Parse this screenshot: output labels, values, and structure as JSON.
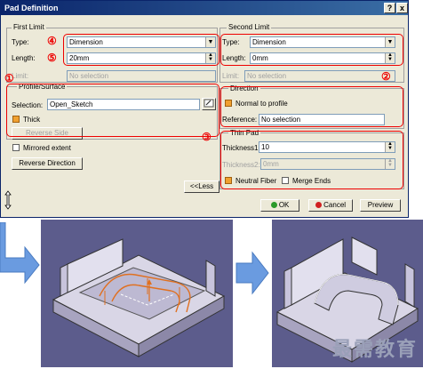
{
  "dialog": {
    "title": "Pad Definition",
    "help_label": "?",
    "close_label": "x"
  },
  "first_limit": {
    "legend": "First Limit",
    "type_label": "Type:",
    "type_value": "Dimension",
    "length_label": "Length:",
    "length_value": "20mm",
    "limit_label": "Limit:",
    "limit_value": "No selection"
  },
  "profile": {
    "legend": "Profile/Surface",
    "selection_label": "Selection:",
    "selection_value": "Open_Sketch",
    "thick_label": "Thick",
    "reverse_side_label": "Reverse Side"
  },
  "options": {
    "mirrored_label": "Mirrored extent",
    "reverse_direction_label": "Reverse Direction",
    "less_label": "<<Less"
  },
  "second_limit": {
    "legend": "Second Limit",
    "type_label": "Type:",
    "type_value": "Dimension",
    "length_label": "Length:",
    "length_value": "0mm",
    "limit_label": "Limit:",
    "limit_value": "No selection"
  },
  "direction": {
    "legend": "Direction",
    "normal_label": "Normal to profile",
    "reference_label": "Reference:",
    "reference_value": "No selection"
  },
  "thin_pad": {
    "legend": "Thin Pad",
    "thickness1_label": "Thickness1:",
    "thickness1_value": "10",
    "thickness2_label": "Thickness2:",
    "thickness2_value": "0mm",
    "neutral_label": "Neutral Fiber",
    "merge_label": "Merge Ends"
  },
  "footer": {
    "ok_label": "OK",
    "cancel_label": "Cancel",
    "preview_label": "Preview"
  },
  "annotations": {
    "n1": "①",
    "n2": "②",
    "n3": "③",
    "n4": "④",
    "n5": "⑤"
  },
  "watermark": "最需教育",
  "colors": {
    "annotation": "#e00000",
    "title_bar": "#0a246a",
    "dialog_bg": "#ece9d8",
    "panel_bg": "#5c5c8c",
    "arrow": "#6a9be0",
    "sketch": "#e07020"
  }
}
